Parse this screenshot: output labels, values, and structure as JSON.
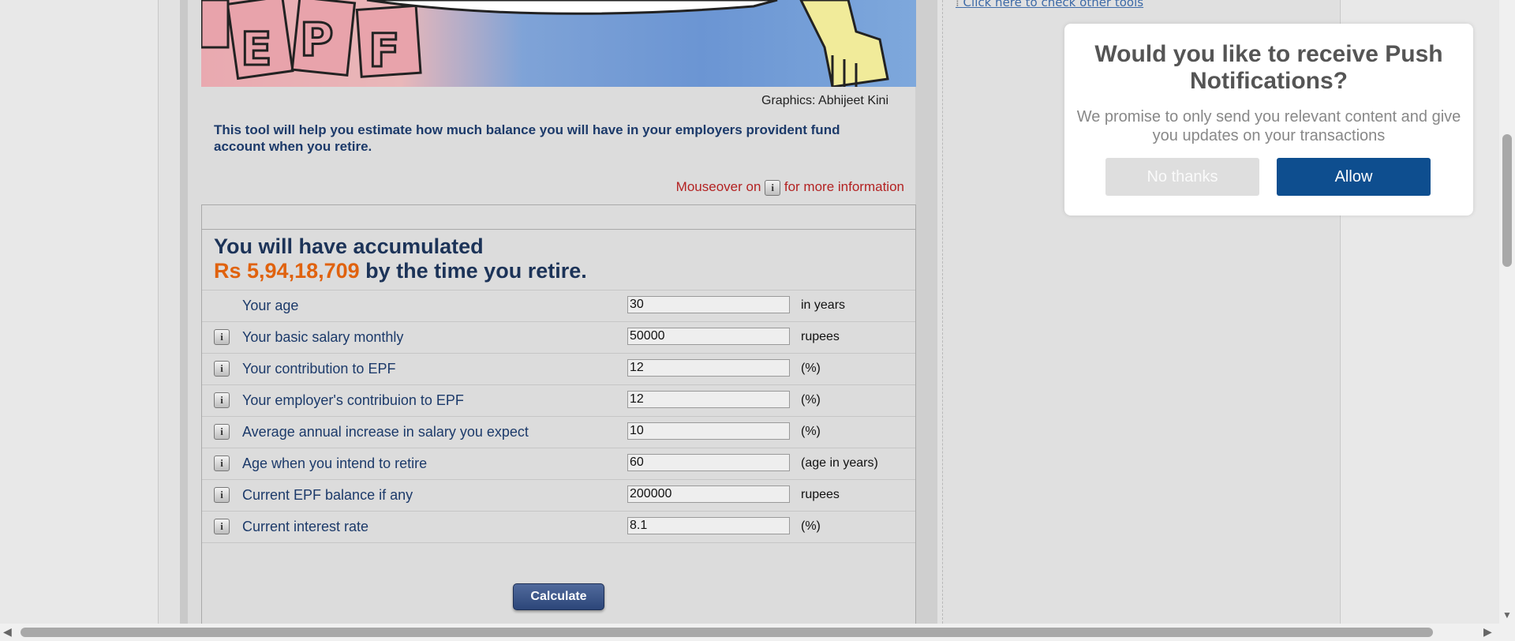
{
  "sidebar": {
    "link_text": "Click here to check other tools"
  },
  "banner": {
    "graphic_text": "EPF",
    "credit": "Graphics: Abhijeet Kini"
  },
  "intro": "This tool will help you estimate how much balance you will have in your employers provident fund account when you retire.",
  "mouseover": {
    "before": "Mouseover on",
    "after": "for more information",
    "icon_label": "i"
  },
  "result": {
    "line1": "You will have accumulated",
    "amount": "Rs 5,94,18,709",
    "suffix": " by the time you retire."
  },
  "fields": [
    {
      "label": "Your age",
      "value": "30",
      "unit": "in years",
      "has_info": false
    },
    {
      "label": "Your basic salary monthly",
      "value": "50000",
      "unit": "rupees",
      "has_info": true
    },
    {
      "label": "Your contribution to EPF",
      "value": "12",
      "unit": "(%)",
      "has_info": true
    },
    {
      "label": "Your employer's contribuion to EPF",
      "value": "12",
      "unit": "(%)",
      "has_info": true
    },
    {
      "label": "Average annual increase in salary you expect",
      "value": "10",
      "unit": "(%)",
      "has_info": true
    },
    {
      "label": "Age when you intend to retire",
      "value": "60",
      "unit": "(age in years)",
      "has_info": true
    },
    {
      "label": "Current EPF balance if any",
      "value": "200000",
      "unit": "rupees",
      "has_info": true
    },
    {
      "label": "Current interest rate",
      "value": "8.1",
      "unit": "(%)",
      "has_info": true
    }
  ],
  "calculate_label": "Calculate",
  "popup": {
    "title": "Would you like to receive Push Notifications?",
    "message": "We promise to only send you relevant content and give you updates on your transactions",
    "no_label": "No thanks",
    "allow_label": "Allow"
  },
  "colors": {
    "accent": "#0e4e8f",
    "amount": "#e0620e",
    "label_text": "#1c3a6a",
    "mouseover_text": "#b32222"
  }
}
